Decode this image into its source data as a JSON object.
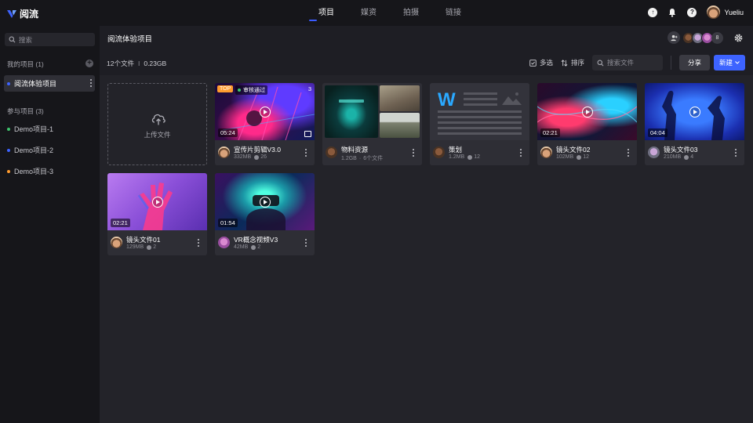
{
  "app": {
    "name": "阅流"
  },
  "nav": {
    "tabs": [
      "项目",
      "媒资",
      "拍摄",
      "链接"
    ],
    "active": 0
  },
  "user": {
    "name": "Yueliu"
  },
  "sidebar": {
    "search_placeholder": "搜索",
    "my_projects_label": "我的项目 (1)",
    "my_projects": [
      {
        "name": "阅流体验项目",
        "dot_color": "#3d63ff"
      }
    ],
    "joined_label": "参与项目 (3)",
    "joined": [
      {
        "name": "Demo项目-1",
        "dot_color": "#3ec46d"
      },
      {
        "name": "Demo项目-2",
        "dot_color": "#3d63ff"
      },
      {
        "name": "Demo项目-3",
        "dot_color": "#ff9b2e"
      }
    ]
  },
  "project": {
    "title": "阅流体验项目",
    "file_count": "12个文件",
    "separator": "I",
    "total_size": "0.23GB",
    "collaborator_extra": "8"
  },
  "toolbar": {
    "multi_select": "多选",
    "sort": "排序",
    "search_placeholder": "搜索文件",
    "share": "分享",
    "new": "新建"
  },
  "upload": {
    "label": "上传文件"
  },
  "cards": [
    {
      "name": "宣传片剪辑V3.0",
      "size": "332MB",
      "comments": "26",
      "duration": "05:24",
      "tag": "TOP",
      "status": "审核通过",
      "version": "3"
    },
    {
      "name": "物料资源",
      "size": "1.2GB",
      "extra": "6个文件"
    },
    {
      "name": "策划",
      "size": "1.2MB",
      "comments": "12"
    },
    {
      "name": "镜头文件02",
      "size": "102MB",
      "comments": "12",
      "duration": "02:21"
    },
    {
      "name": "镜头文件03",
      "size": "210MB",
      "comments": "4",
      "duration": "04:04"
    },
    {
      "name": "镜头文件01",
      "size": "129MB",
      "comments": "2",
      "duration": "02:21"
    },
    {
      "name": "VR概念视频V3",
      "size": "42MB",
      "comments": "2",
      "duration": "01:54"
    }
  ],
  "colors": {
    "accent": "#3d63ff",
    "top_tag": "#ff9b2e",
    "approved": "#3ec46d"
  },
  "icons": [
    "logo-icon",
    "upload-icon",
    "bell-icon",
    "help-icon",
    "search-icon",
    "add-icon",
    "gear-icon",
    "checkbox-icon",
    "sort-icon",
    "play-icon",
    "cloud-upload-icon",
    "chevron-down-icon",
    "more-icon",
    "comment-icon",
    "versions-icon"
  ]
}
